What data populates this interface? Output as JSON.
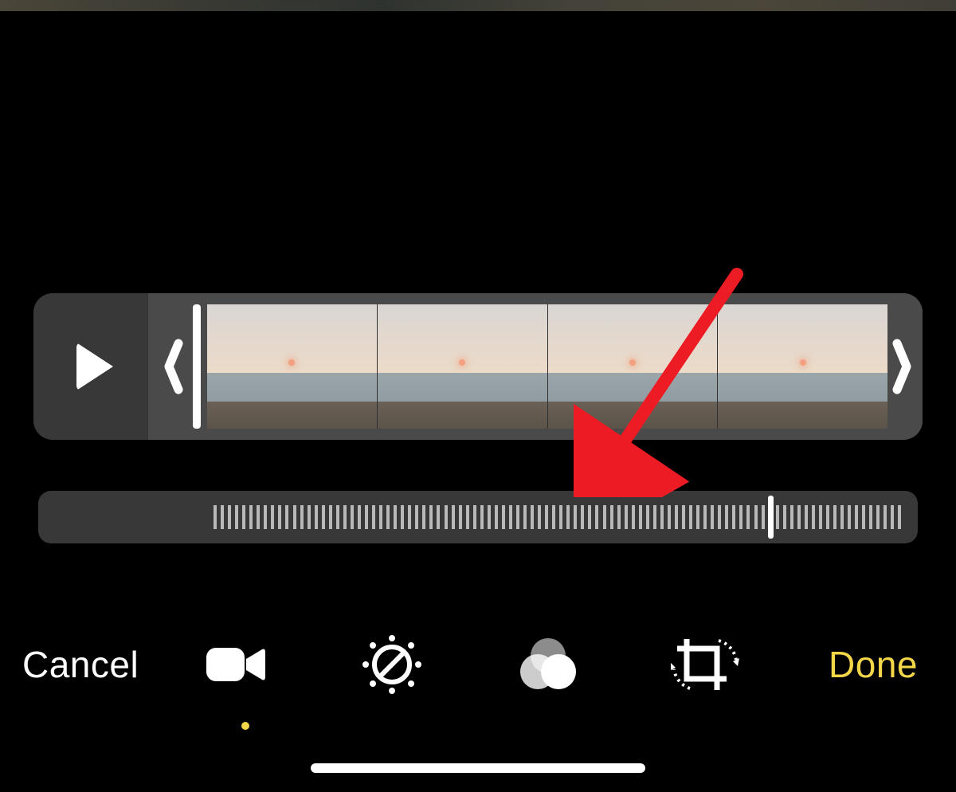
{
  "toolbar": {
    "cancel_label": "Cancel",
    "done_label": "Done",
    "active_tool": "video",
    "tools": [
      "video",
      "adjust",
      "filters",
      "crop"
    ]
  },
  "slider": {
    "position_percent": 83
  },
  "annotation": {
    "arrow_color": "#ed1c24"
  },
  "colors": {
    "accent": "#f4d649",
    "panel": "#383838"
  }
}
